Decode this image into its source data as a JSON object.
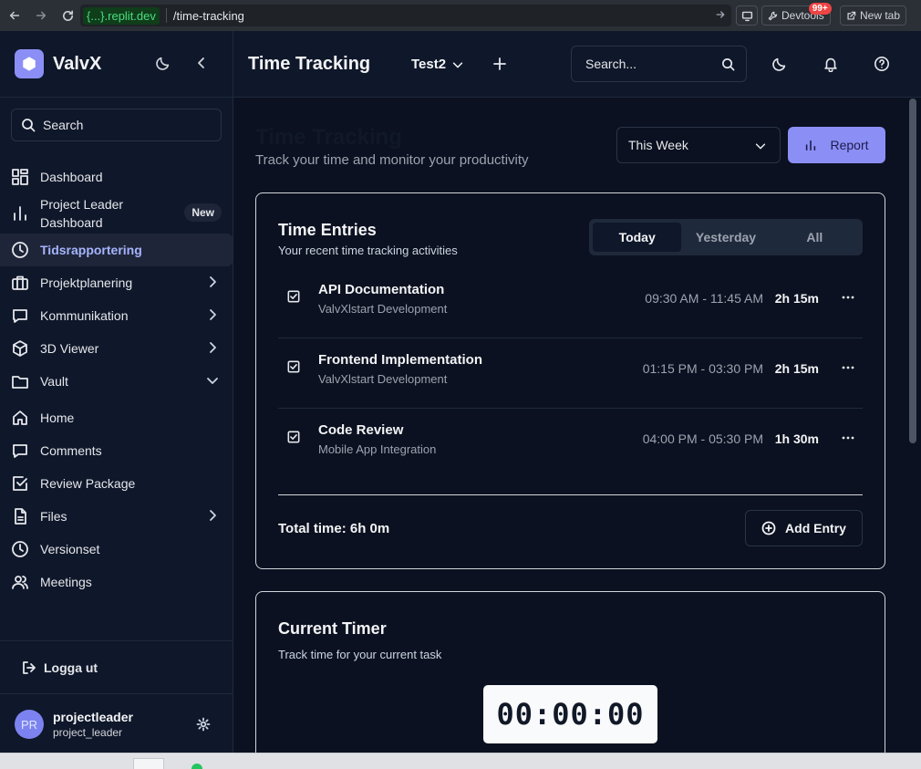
{
  "browser": {
    "host": "{...}.replit.dev",
    "path": "/time-tracking",
    "devtools_label": "Devtools",
    "devtools_badge": "99+",
    "newtab_label": "New tab"
  },
  "sidebar": {
    "brand": "ValvX",
    "search_label": "Search",
    "items": [
      {
        "label": "Dashboard",
        "icon": "dashboard-icon"
      },
      {
        "label": "Project Leader Dashboard",
        "line1": "Project Leader",
        "line2": "Dashboard",
        "badge": "New",
        "icon": "bar-chart-icon"
      },
      {
        "label": "Tidsrapportering",
        "icon": "clock-icon",
        "active": true
      },
      {
        "label": "Projektplanering",
        "icon": "briefcase-icon"
      },
      {
        "label": "Kommunikation",
        "icon": "message-icon"
      },
      {
        "label": "3D Viewer",
        "icon": "cube-icon"
      },
      {
        "label": "Vault",
        "icon": "folder-icon"
      },
      {
        "label": "Home",
        "icon": "home-icon"
      },
      {
        "label": "Comments",
        "icon": "comment-icon"
      },
      {
        "label": "Review Package",
        "icon": "check-square-icon"
      },
      {
        "label": "Files",
        "icon": "file-icon"
      },
      {
        "label": "Versionset",
        "icon": "history-icon"
      },
      {
        "label": "Meetings",
        "icon": "users-icon"
      }
    ],
    "logout_label": "Logga ut",
    "user": {
      "initials": "PR",
      "name": "projectleader",
      "handle": "project_leader"
    }
  },
  "header": {
    "title": "Time Tracking",
    "project": "Test2",
    "search_placeholder": "Search..."
  },
  "main": {
    "title": "Time Tracking",
    "subtitle": "Track your time and monitor your productivity",
    "period": "This Week",
    "report_label": "Report"
  },
  "entries_card": {
    "title": "Time Entries",
    "subtitle": "Your recent time tracking activities",
    "tabs": [
      "Today",
      "Yesterday",
      "All"
    ],
    "entries": [
      {
        "name": "API Documentation",
        "project": "ValvXlstart Development",
        "time": "09:30 AM - 11:45 AM",
        "duration": "2h 15m"
      },
      {
        "name": "Frontend Implementation",
        "project": "ValvXlstart Development",
        "time": "01:15 PM - 03:30 PM",
        "duration": "2h 15m"
      },
      {
        "name": "Code Review",
        "project": "Mobile App Integration",
        "time": "04:00 PM - 05:30 PM",
        "duration": "1h 30m"
      }
    ],
    "total": "Total time: 6h 0m",
    "add_label": "Add Entry"
  },
  "timer_card": {
    "title": "Current Timer",
    "subtitle": "Track time for your current task",
    "display": "00:00:00"
  },
  "colors": {
    "accent": "#8b8ff5",
    "background": "#0b1120",
    "sidebar": "#0f172a"
  }
}
